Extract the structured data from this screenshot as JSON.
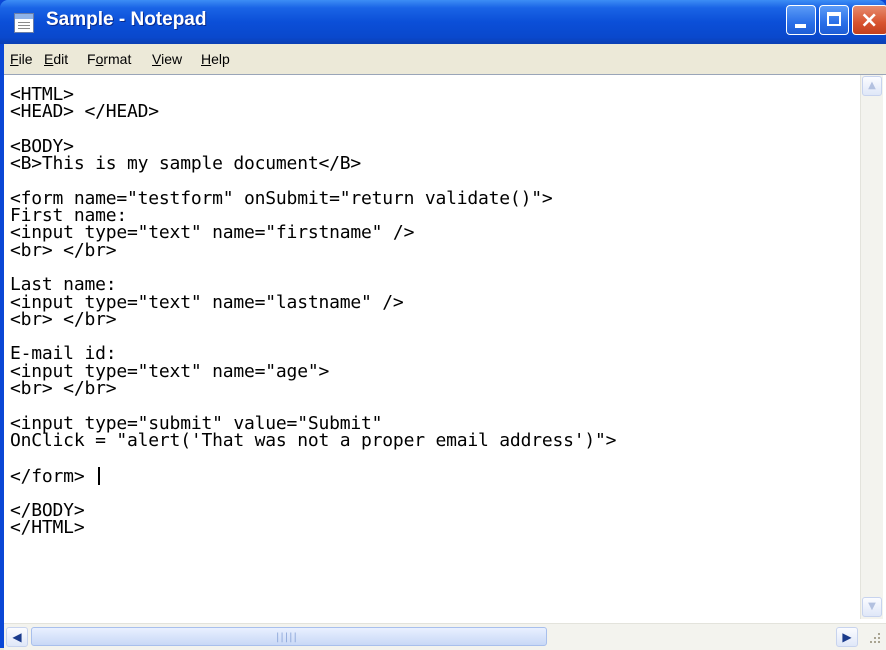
{
  "window": {
    "title": "Sample - Notepad",
    "controls": {
      "minimize": "minimize",
      "maximize": "maximize",
      "close": "×"
    }
  },
  "menu": [
    {
      "accel": "F",
      "rest": "ile"
    },
    {
      "accel": "E",
      "rest": "dit"
    },
    {
      "pre": "F",
      "accel": "o",
      "rest": "rmat"
    },
    {
      "accel": "V",
      "rest": "iew"
    },
    {
      "accel": "H",
      "rest": "elp"
    }
  ],
  "editor": {
    "content_lines": [
      "<HTML>",
      "<HEAD> </HEAD>",
      "",
      "<BODY>",
      "<B>This is my sample document</B>",
      "",
      "<form name=\"testform\" onSubmit=\"return validate()\">",
      "First name:",
      "<input type=\"text\" name=\"firstname\" />",
      "<br> </br>",
      "",
      "Last name:",
      "<input type=\"text\" name=\"lastname\" />",
      "<br> </br>",
      "",
      "E-mail id:",
      "<input type=\"text\" name=\"age\">",
      "<br> </br>",
      "",
      "<input type=\"submit\" value=\"Submit\"",
      "OnClick = \"alert('That was not a proper email address')\">",
      "",
      "</form> ",
      "",
      "</BODY>",
      "</HTML>"
    ],
    "cursor_line": 22
  },
  "icons": {
    "app": "notepad-icon",
    "scroll_up": "arrow-up-icon",
    "scroll_down": "arrow-down-icon",
    "scroll_left": "arrow-left-icon",
    "scroll_right": "arrow-right-icon"
  }
}
